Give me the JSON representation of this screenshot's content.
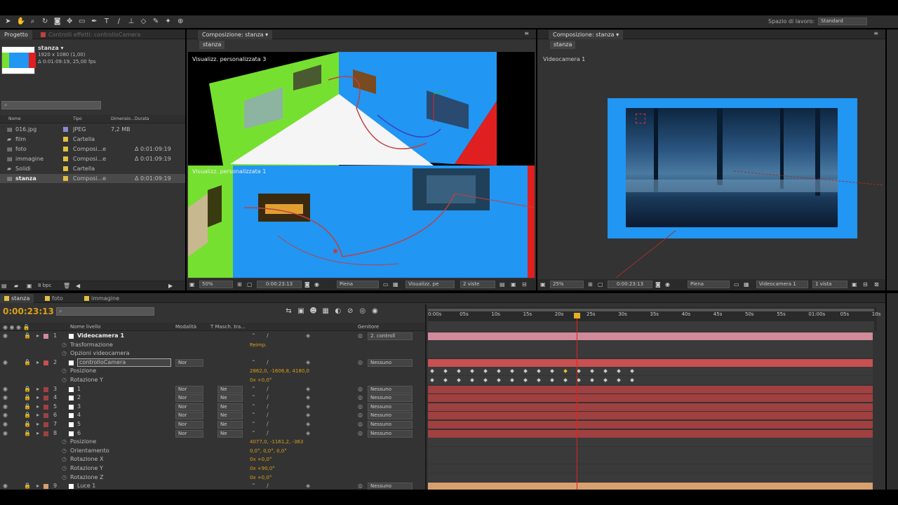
{
  "toolbar": {
    "workspace_label": "Spazio di lavoro:",
    "workspace_value": "Standard"
  },
  "project": {
    "tab_project": "Progetto",
    "tab_controls": "Controlli effetti: controlloCamera",
    "item_name": "stanza ▾",
    "item_info1": "1920 x 1080 (1,00)",
    "item_info2": "Δ 0:01:09:19, 25,00 fps",
    "col_name": "Nome",
    "col_type": "Tipo",
    "col_size": "Dimensio...",
    "col_duration": "Durata",
    "items": [
      {
        "name": "016.jpg",
        "type": "JPEG",
        "size": "7,2 MB",
        "dur": "",
        "color": "#8a8ad0"
      },
      {
        "name": "film",
        "type": "Cartella",
        "size": "",
        "dur": "",
        "color": "#e0c040"
      },
      {
        "name": "foto",
        "type": "Composi...e",
        "size": "",
        "dur": "Δ 0:01:09:19",
        "color": "#e0c040"
      },
      {
        "name": "immagine",
        "type": "Composi...e",
        "size": "",
        "dur": "Δ 0:01:09:19",
        "color": "#e0c040"
      },
      {
        "name": "Solidi",
        "type": "Cartella",
        "size": "",
        "dur": "",
        "color": "#e0c040"
      },
      {
        "name": "stanza",
        "type": "Composi...e",
        "size": "",
        "dur": "Δ 0:01:09:19",
        "color": "#e0c040"
      }
    ],
    "bpc": "8 bpc"
  },
  "comp_left": {
    "tab": "Composizione: stanza",
    "sub_tab": "stanza",
    "view1": "Visualizz. personalizzata 3",
    "view2": "Visualizz. personalizzata 1",
    "zoom": "50%",
    "time": "0:00:23:13",
    "res": "Piena",
    "view": "Visualizz. pe",
    "layout": "2 viste"
  },
  "comp_right": {
    "tab": "Composizione: stanza",
    "sub_tab": "stanza",
    "view": "Videocamera 1",
    "zoom": "25%",
    "time": "0:00:23:13",
    "res": "Piena",
    "camera": "Videocamera 1",
    "layout": "1 vista"
  },
  "timeline": {
    "tabs": [
      "stanza",
      "foto",
      "immagine"
    ],
    "timecode": "0:00:23:13",
    "col_layer": "Nome livello",
    "col_mode": "Modalità",
    "col_track": "T  Masch. tra...",
    "col_parent": "Genitore",
    "ruler": [
      "0:00s",
      "05s",
      "10s",
      "15s",
      "20s",
      "25s",
      "30s",
      "35s",
      "40s",
      "45s",
      "50s",
      "55s",
      "01:00s",
      "05s",
      "10s"
    ],
    "layers": [
      {
        "n": "1",
        "name": "Videocamera 1",
        "mode": "",
        "track": "",
        "parent": "2. controll",
        "bar": "#d08a9a",
        "bold": true
      },
      {
        "n": "",
        "name": "Trasformazione",
        "value": "Reimp.",
        "sub": true
      },
      {
        "n": "",
        "name": "Opzioni videocamera",
        "sub": true
      },
      {
        "n": "2",
        "name": "controlloCamera",
        "mode": "Nor",
        "track": "",
        "parent": "Nessuno",
        "bar": "#c85050",
        "selected": true
      },
      {
        "n": "",
        "name": "Posizione",
        "value": "2862,0, -1606,8, 4180,0",
        "sub": true
      },
      {
        "n": "",
        "name": "Rotazione Y",
        "value": "0x +0,0°",
        "sub": true
      },
      {
        "n": "3",
        "name": "1",
        "mode": "Nor",
        "track": "Ne",
        "parent": "Nessuno",
        "bar": "#a04040"
      },
      {
        "n": "4",
        "name": "2",
        "mode": "Nor",
        "track": "Ne",
        "parent": "Nessuno",
        "bar": "#a04040"
      },
      {
        "n": "5",
        "name": "3",
        "mode": "Nor",
        "track": "Ne",
        "parent": "Nessuno",
        "bar": "#a04040"
      },
      {
        "n": "6",
        "name": "4",
        "mode": "Nor",
        "track": "Ne",
        "parent": "Nessuno",
        "bar": "#a04040"
      },
      {
        "n": "7",
        "name": "5",
        "mode": "Nor",
        "track": "Ne",
        "parent": "Nessuno",
        "bar": "#a04040"
      },
      {
        "n": "8",
        "name": "6",
        "mode": "Nor",
        "track": "Ne",
        "parent": "Nessuno",
        "bar": "#a04040"
      },
      {
        "n": "",
        "name": "Posizione",
        "value": "4077,0, -1161,2, -363",
        "sub": true
      },
      {
        "n": "",
        "name": "Orientamento",
        "value": "0,0°, 0,0°, 0,0°",
        "sub": true
      },
      {
        "n": "",
        "name": "Rotazione X",
        "value": "0x +0,0°",
        "sub": true
      },
      {
        "n": "",
        "name": "Rotazione Y",
        "value": "0x +90,0°",
        "sub": true
      },
      {
        "n": "",
        "name": "Rotazione Z",
        "value": "0x +0,0°",
        "sub": true
      },
      {
        "n": "9",
        "name": "Luce 1",
        "mode": "",
        "track": "",
        "parent": "Nessuno",
        "bar": "#d8a070"
      }
    ]
  }
}
